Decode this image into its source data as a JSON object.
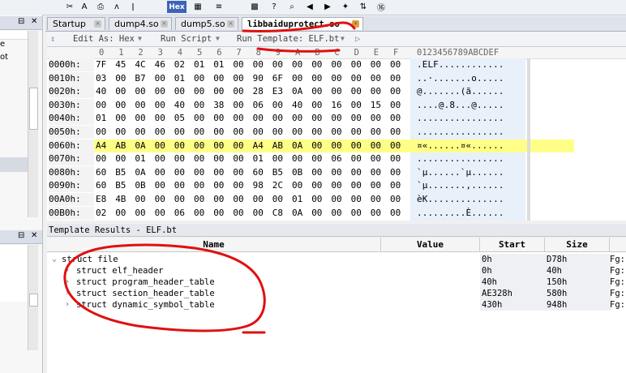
{
  "toolbar": {
    "hex_label": "Hex"
  },
  "tabs": [
    {
      "label": "Startup"
    },
    {
      "label": "dump4.so"
    },
    {
      "label": "dump5.so"
    },
    {
      "label": "libbaiduprotect.so"
    }
  ],
  "editor_toolbar": {
    "edit_as": "Edit As: Hex",
    "run_script": "Run Script",
    "run_template": "Run Template: ELF.bt"
  },
  "hex": {
    "columns": [
      "0",
      "1",
      "2",
      "3",
      "4",
      "5",
      "6",
      "7",
      "8",
      "9",
      "A",
      "B",
      "C",
      "D",
      "E",
      "F"
    ],
    "ascii_header": "0123456789ABCDEF",
    "rows": [
      {
        "addr": "0000h:",
        "bytes": [
          "7F",
          "45",
          "4C",
          "46",
          "02",
          "01",
          "01",
          "00",
          "00",
          "00",
          "00",
          "00",
          "00",
          "00",
          "00",
          "00"
        ],
        "ascii": ".ELF............"
      },
      {
        "addr": "0010h:",
        "bytes": [
          "03",
          "00",
          "B7",
          "00",
          "01",
          "00",
          "00",
          "00",
          "90",
          "6F",
          "00",
          "00",
          "00",
          "00",
          "00",
          "00"
        ],
        "ascii": "..·.......o....."
      },
      {
        "addr": "0020h:",
        "bytes": [
          "40",
          "00",
          "00",
          "00",
          "00",
          "00",
          "00",
          "00",
          "28",
          "E3",
          "0A",
          "00",
          "00",
          "00",
          "00",
          "00"
        ],
        "ascii": "@.......(ã......"
      },
      {
        "addr": "0030h:",
        "bytes": [
          "00",
          "00",
          "00",
          "00",
          "40",
          "00",
          "38",
          "00",
          "06",
          "00",
          "40",
          "00",
          "16",
          "00",
          "15",
          "00"
        ],
        "ascii": "....@.8...@....."
      },
      {
        "addr": "0040h:",
        "bytes": [
          "01",
          "00",
          "00",
          "00",
          "05",
          "00",
          "00",
          "00",
          "00",
          "00",
          "00",
          "00",
          "00",
          "00",
          "00",
          "00"
        ],
        "ascii": "................"
      },
      {
        "addr": "0050h:",
        "bytes": [
          "00",
          "00",
          "00",
          "00",
          "00",
          "00",
          "00",
          "00",
          "00",
          "00",
          "00",
          "00",
          "00",
          "00",
          "00",
          "00"
        ],
        "ascii": "................"
      },
      {
        "addr": "0060h:",
        "bytes": [
          "A4",
          "AB",
          "0A",
          "00",
          "00",
          "00",
          "00",
          "00",
          "A4",
          "AB",
          "0A",
          "00",
          "00",
          "00",
          "00",
          "00"
        ],
        "ascii": "¤«......¤«......",
        "highlight": true
      },
      {
        "addr": "0070h:",
        "bytes": [
          "00",
          "00",
          "01",
          "00",
          "00",
          "00",
          "00",
          "00",
          "01",
          "00",
          "00",
          "00",
          "06",
          "00",
          "00",
          "00"
        ],
        "ascii": "................"
      },
      {
        "addr": "0080h:",
        "bytes": [
          "60",
          "B5",
          "0A",
          "00",
          "00",
          "00",
          "00",
          "00",
          "60",
          "B5",
          "0B",
          "00",
          "00",
          "00",
          "00",
          "00"
        ],
        "ascii": "`µ......`µ......"
      },
      {
        "addr": "0090h:",
        "bytes": [
          "60",
          "B5",
          "0B",
          "00",
          "00",
          "00",
          "00",
          "00",
          "98",
          "2C",
          "00",
          "00",
          "00",
          "00",
          "00",
          "00"
        ],
        "ascii": "`µ.......,......"
      },
      {
        "addr": "00A0h:",
        "bytes": [
          "E8",
          "4B",
          "00",
          "00",
          "00",
          "00",
          "00",
          "00",
          "00",
          "00",
          "01",
          "00",
          "00",
          "00",
          "00",
          "00"
        ],
        "ascii": "èK.............."
      },
      {
        "addr": "00B0h:",
        "bytes": [
          "02",
          "00",
          "00",
          "00",
          "06",
          "00",
          "00",
          "00",
          "00",
          "C8",
          "0A",
          "00",
          "00",
          "00",
          "00",
          "00"
        ],
        "ascii": ".........È......"
      }
    ]
  },
  "template_results": {
    "title": "Template Results - ELF.bt",
    "columns": [
      "Name",
      "Value",
      "Start",
      "Size"
    ],
    "rows": [
      {
        "name": "struct file",
        "value": "",
        "start": "0h",
        "size": "D78h",
        "extra": "Fg:"
      },
      {
        "name": "struct elf_header",
        "value": "",
        "start": "0h",
        "size": "40h",
        "extra": "Fg:"
      },
      {
        "name": "struct program_header_table",
        "value": "",
        "start": "40h",
        "size": "150h",
        "extra": "Fg:"
      },
      {
        "name": "struct section_header_table",
        "value": "",
        "start": "AE328h",
        "size": "580h",
        "extra": "Fg:"
      },
      {
        "name": "struct dynamic_symbol_table",
        "value": "",
        "start": "430h",
        "size": "948h",
        "extra": "Fg:"
      }
    ]
  },
  "left_panel": {
    "text_1": "e",
    "text_2": "ot"
  },
  "colors": {
    "highlight": "#ffff88",
    "annotation": "#e01010",
    "hex_button": "#3d63b8"
  }
}
